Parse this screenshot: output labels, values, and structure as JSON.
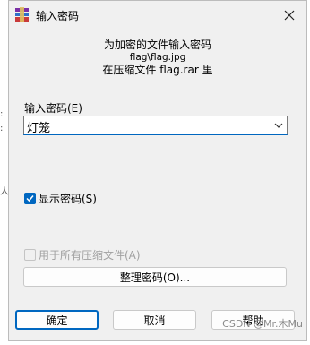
{
  "background_fragments": [
    ":",
    ":",
    "人"
  ],
  "dialog": {
    "title": "输入密码",
    "info_line1": "为加密的文件输入密码",
    "info_line2": "flag\\flag.jpg",
    "info_line3": "在压缩文件 flag.rar 里",
    "password_label": "输入密码(E)",
    "password_value": "灯笼",
    "show_password_label": "显示密码(S)",
    "show_password_checked": true,
    "use_for_all_label": "用于所有压缩文件(A)",
    "use_for_all_checked": false,
    "organize_button": "整理密码(O)...",
    "ok_button": "确定",
    "cancel_button": "取消",
    "help_button": "帮助"
  },
  "watermark": "CSDN @Mr.木Mu",
  "colors": {
    "accent": "#0067c0",
    "dialog_bg": "#f0f0f0",
    "disabled_text": "#a0a0a0"
  }
}
